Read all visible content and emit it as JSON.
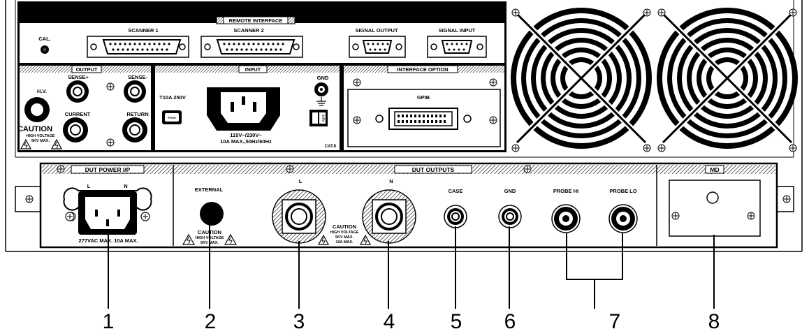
{
  "remote_interface": {
    "title": "REMOTE INTERFACE",
    "cal": "CAL.",
    "scanner1": "SCANNER 1",
    "scanner2": "SCANNER 2",
    "signal_output": "SIGNAL OUTPUT",
    "signal_input": "SIGNAL INPUT"
  },
  "output": {
    "title": "OUTPUT",
    "sense_plus": "SENSE+",
    "sense_minus": "SENSE-",
    "hv": "H.V.",
    "current": "CURRENT",
    "return": "RETURN",
    "caution": "CAUTION",
    "caution_line1": "HIGH VOLTAGE",
    "caution_line2": "5KV MAX."
  },
  "input": {
    "title": "INPUT",
    "fuse": "T10A 250V",
    "fuse_knob": "PUSH",
    "gnd": "GND",
    "rating1": "115V~/230V~",
    "rating2": "10A MAX.,50Hz/60Hz",
    "cat": "CAT.II",
    "switch_label": "115V"
  },
  "interface_option": {
    "title": "INTERFACE OPTION",
    "gpib": "GPIB"
  },
  "dut_power": {
    "title": "DUT POWER I/P",
    "l": "L",
    "n": "N",
    "rating": "277VAC MAX. 10A MAX."
  },
  "dut_outputs": {
    "title": "DUT OUTPUTS",
    "external": "EXTERNAL",
    "caution": "CAUTION",
    "caution_hv": "HIGH VOLTAGE",
    "caution_5kv": "5KV MAX.",
    "caution_10a": "10A MAX.",
    "l": "L",
    "n": "N",
    "case": "CASE",
    "gnd": "GND",
    "probe_hi": "PROBE HI",
    "probe_lo": "PROBE LO"
  },
  "md": {
    "title": "MD"
  },
  "callouts": [
    "1",
    "2",
    "3",
    "4",
    "5",
    "6",
    "7",
    "8"
  ]
}
